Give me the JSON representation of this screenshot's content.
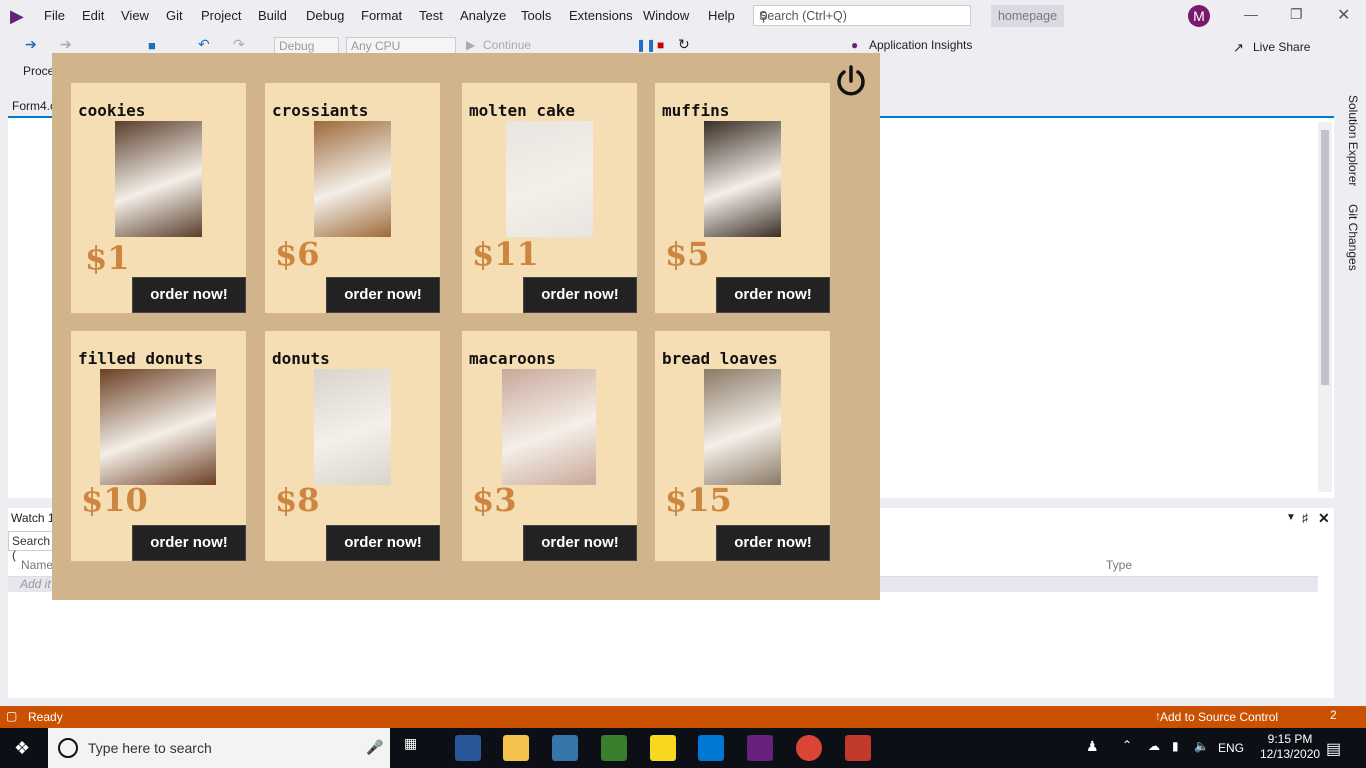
{
  "menu": [
    "File",
    "Edit",
    "View",
    "Git",
    "Project",
    "Build",
    "Debug",
    "Format",
    "Test",
    "Analyze",
    "Tools",
    "Extensions",
    "Window",
    "Help"
  ],
  "search_placeholder": "Search (Ctrl+Q)",
  "solution_name": "homepage",
  "avatar_initial": "M",
  "toolbar": {
    "config": "Debug",
    "platform": "Any CPU",
    "continue_label": "Continue",
    "app_insights": "Application Insights",
    "live_share": "Live Share",
    "process_label": "Proce"
  },
  "doc_tab": "Form4.c",
  "side_tabs": [
    "Solution Explorer",
    "Git Changes"
  ],
  "watch": {
    "title": "Watch 1",
    "search_placeholder": "Search (",
    "col_name": "Name",
    "col_type": "Type",
    "add_item": "Add it"
  },
  "status": {
    "ready": "Ready",
    "source_control": "Add to Source Control",
    "notifications": "2"
  },
  "taskbar": {
    "search_text": "Type here to search",
    "time": "9:15 PM",
    "date": "12/13/2020",
    "lang": "ENG"
  },
  "bakery": {
    "order_label": "order now!",
    "items": [
      {
        "name": "cookies",
        "price": "$1",
        "img_color": "#5a3d2b"
      },
      {
        "name": "crossiants",
        "price": "$6",
        "img_color": "#9c6a3a"
      },
      {
        "name": "molten cake",
        "price": "$11",
        "img_color": "#e8e4e0"
      },
      {
        "name": "muffins",
        "price": "$5",
        "img_color": "#3a2e26"
      },
      {
        "name": "filled donuts",
        "price": "$10",
        "img_color": "#6b3f24"
      },
      {
        "name": "donuts",
        "price": "$8",
        "img_color": "#d9d4cc"
      },
      {
        "name": "macaroons",
        "price": "$3",
        "img_color": "#c9a89a"
      },
      {
        "name": "bread loaves",
        "price": "$15",
        "img_color": "#8a7a66"
      }
    ]
  }
}
